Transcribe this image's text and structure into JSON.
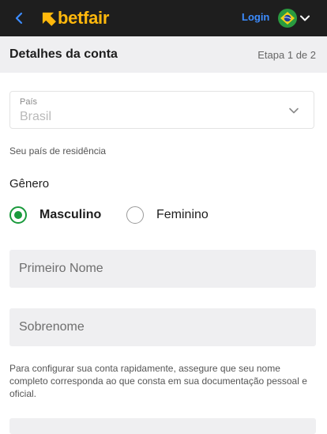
{
  "header": {
    "brand": "betfair",
    "login_label": "Login",
    "colors": {
      "bar": "#1e1e1e",
      "brand": "#ffb80c",
      "link": "#3c8cff"
    }
  },
  "subheader": {
    "title": "Detalhes da conta",
    "step": "Etapa 1 de 2"
  },
  "country": {
    "label": "País",
    "value": "Brasil",
    "helper": "Seu país de residência"
  },
  "gender": {
    "label": "Gênero",
    "options": [
      {
        "label": "Masculino",
        "selected": true
      },
      {
        "label": "Feminino",
        "selected": false
      }
    ],
    "accent": "#1a9a3c"
  },
  "fields": {
    "first_name_placeholder": "Primeiro Nome",
    "last_name_placeholder": "Sobrenome"
  },
  "note": "Para configurar sua conta rapidamente, assegure que seu nome completo corresponda ao que consta em sua documentação pessoal e oficial."
}
